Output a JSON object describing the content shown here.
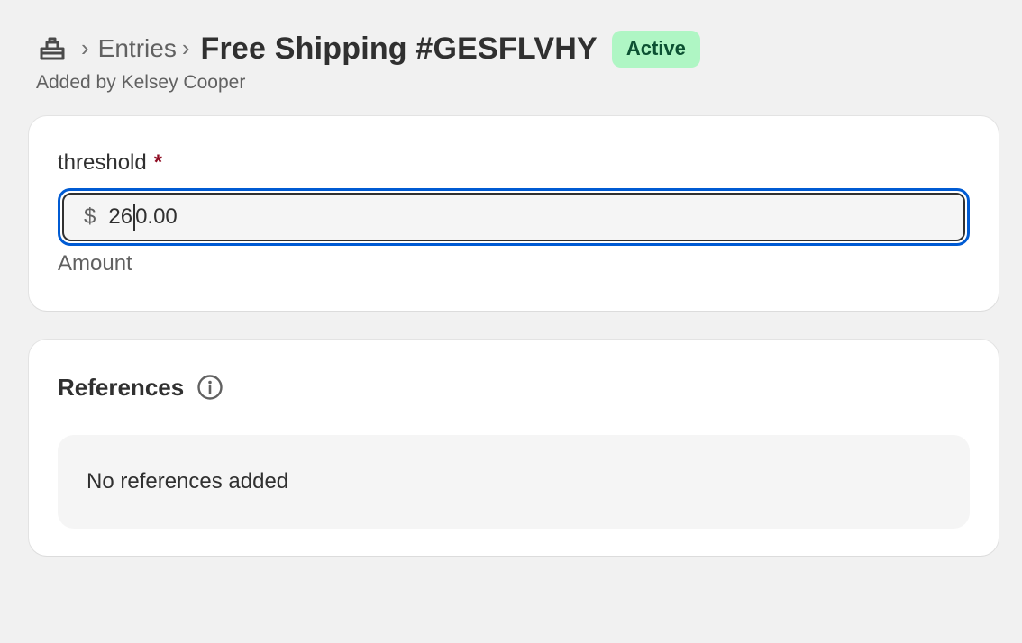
{
  "breadcrumb": {
    "home_icon": "store-icon",
    "separator": "›",
    "parent_label": "Entries"
  },
  "header": {
    "title": "Free Shipping #GESFLVHY",
    "status": "Active",
    "status_color": "#aff6c4",
    "subtitle": "Added by Kelsey Cooper"
  },
  "threshold_field": {
    "label": "threshold",
    "required_mark": "*",
    "prefix": "$",
    "value_before_caret": "26",
    "value_after_caret": "0.00",
    "help_text": "Amount",
    "focus_color": "#005bd3"
  },
  "references": {
    "title": "References",
    "info_icon": "info-icon",
    "empty_text": "No references added"
  }
}
